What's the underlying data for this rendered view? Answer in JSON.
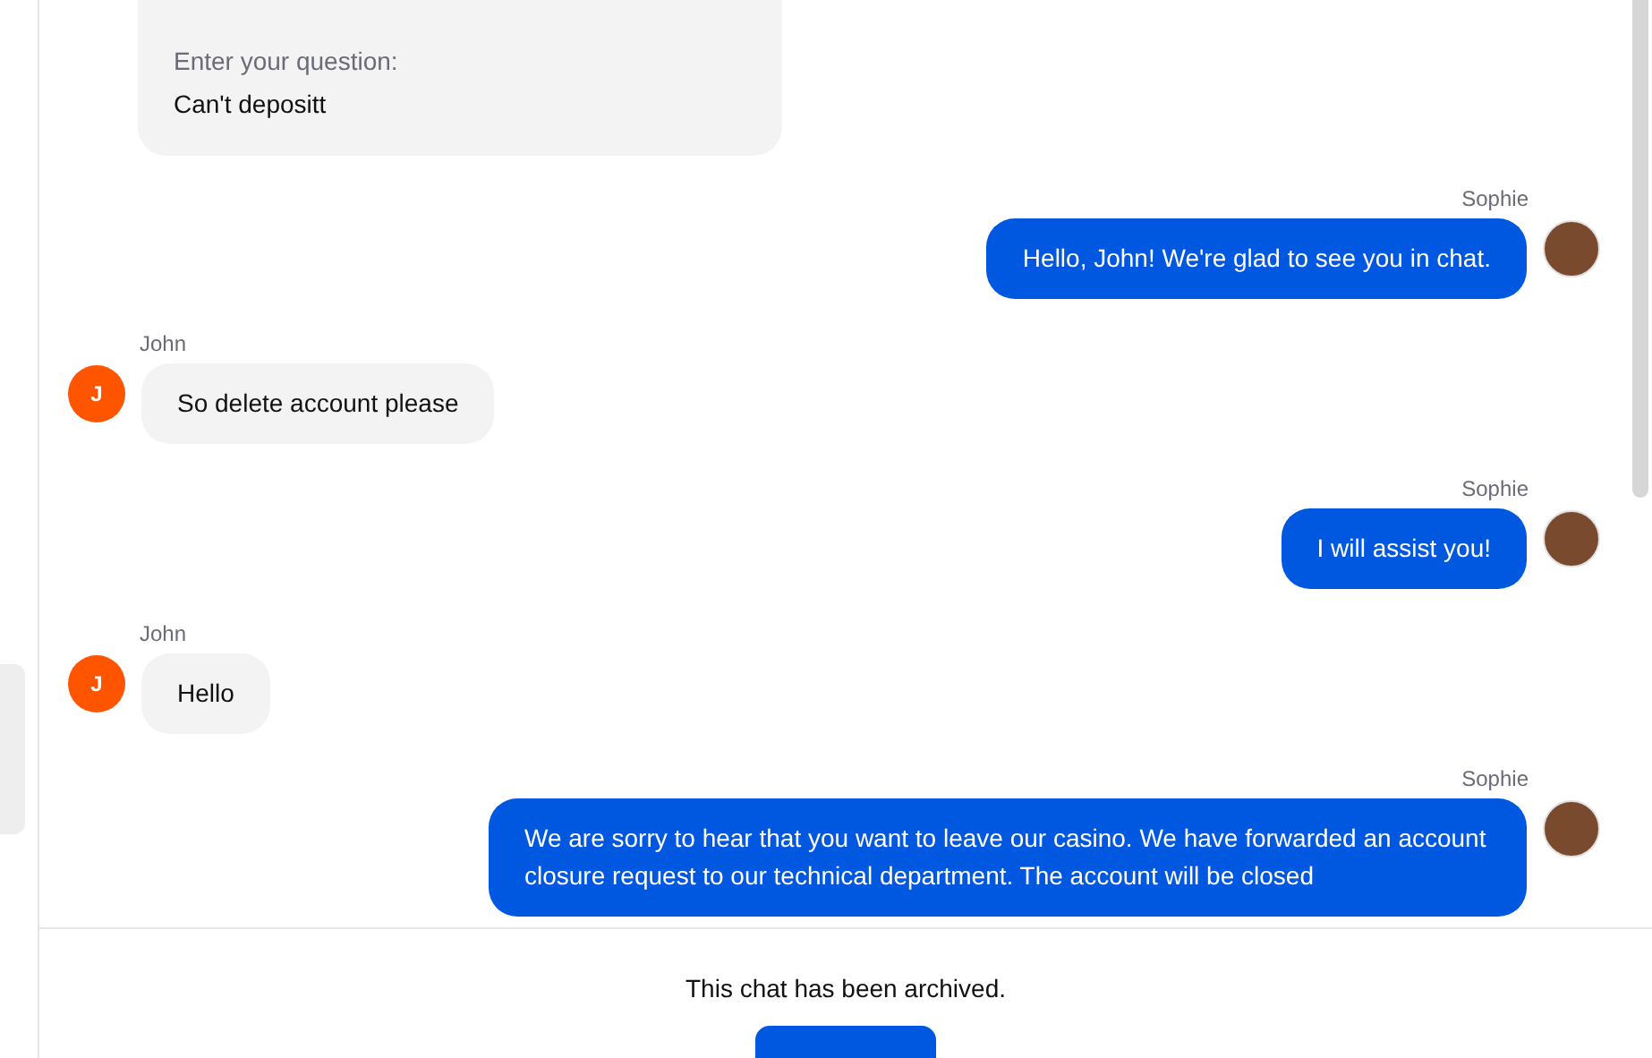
{
  "form_card": {
    "fields": [
      {
        "label": "Enter your question:",
        "value": "Can't depositt"
      }
    ]
  },
  "messages": [
    {
      "kind": "agent",
      "sender": "Sophie",
      "text": "Hello, John! We're glad to see you in chat."
    },
    {
      "kind": "customer",
      "sender": "John",
      "initial": "J",
      "text": "So delete account please"
    },
    {
      "kind": "agent",
      "sender": "Sophie",
      "text": "I will assist you!"
    },
    {
      "kind": "customer",
      "sender": "John",
      "initial": "J",
      "text": "Hello"
    },
    {
      "kind": "agent",
      "sender": "Sophie",
      "text": "We are sorry to hear that you want to leave our casino. We have forwarded an account closure request to our technical department. The account will be closed"
    }
  ],
  "footer": {
    "notice": "This chat has been archived."
  }
}
